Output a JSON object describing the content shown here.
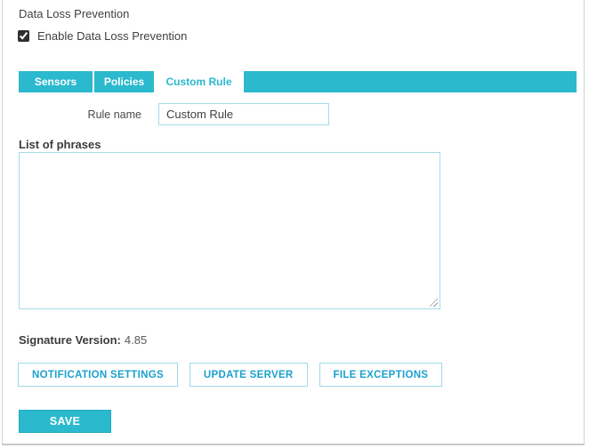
{
  "page": {
    "title": "Data Loss Prevention"
  },
  "enable": {
    "label": "Enable Data Loss Prevention",
    "checked_attr": "checked"
  },
  "tabs": [
    {
      "label": "Sensors",
      "active": false
    },
    {
      "label": "Policies",
      "active": false
    },
    {
      "label": "Custom Rule",
      "active": true
    }
  ],
  "form": {
    "rule_name_label": "Rule name",
    "rule_name_value": "Custom Rule",
    "phrases_label": "List of phrases",
    "phrases_value": ""
  },
  "signature": {
    "label": "Signature Version:",
    "value": "4.85"
  },
  "actions": {
    "notification_settings": "NOTIFICATION SETTINGS",
    "update_server": "UPDATE SERVER",
    "file_exceptions": "FILE EXCEPTIONS",
    "save": "SAVE"
  },
  "colors": {
    "accent_cyan": "#2bb9ce",
    "light_cyan_border": "#a5dbe9",
    "button_text": "#1ba0cd",
    "panel_border": "#d4d4d4",
    "text": "#3f3f3f"
  }
}
